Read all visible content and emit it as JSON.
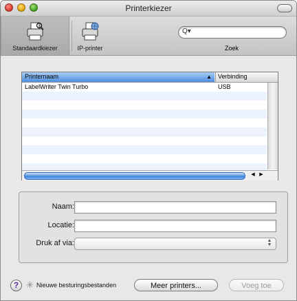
{
  "window": {
    "title": "Printerkiezer"
  },
  "toolbar": {
    "items": [
      {
        "label": "Standaardkiezer",
        "icon": "printer-icon",
        "selected": true
      },
      {
        "label": "IP-printer",
        "icon": "network-printer-icon",
        "selected": false
      }
    ],
    "search": {
      "label": "Zoek",
      "value": ""
    }
  },
  "printer_list": {
    "columns": {
      "name": "Printernaam",
      "connection": "Verbinding"
    },
    "rows": [
      {
        "name": "LabelWriter Twin Turbo",
        "connection": "USB"
      }
    ]
  },
  "form": {
    "name_label": "Naam:",
    "name_value": "",
    "location_label": "Locatie:",
    "location_value": "",
    "print_via_label": "Druk af via:",
    "print_via_value": ""
  },
  "footer": {
    "help_label": "?",
    "status_text": "Nieuwe besturingsbestanden",
    "more_printers_label": "Meer printers...",
    "add_label": "Voeg toe"
  }
}
